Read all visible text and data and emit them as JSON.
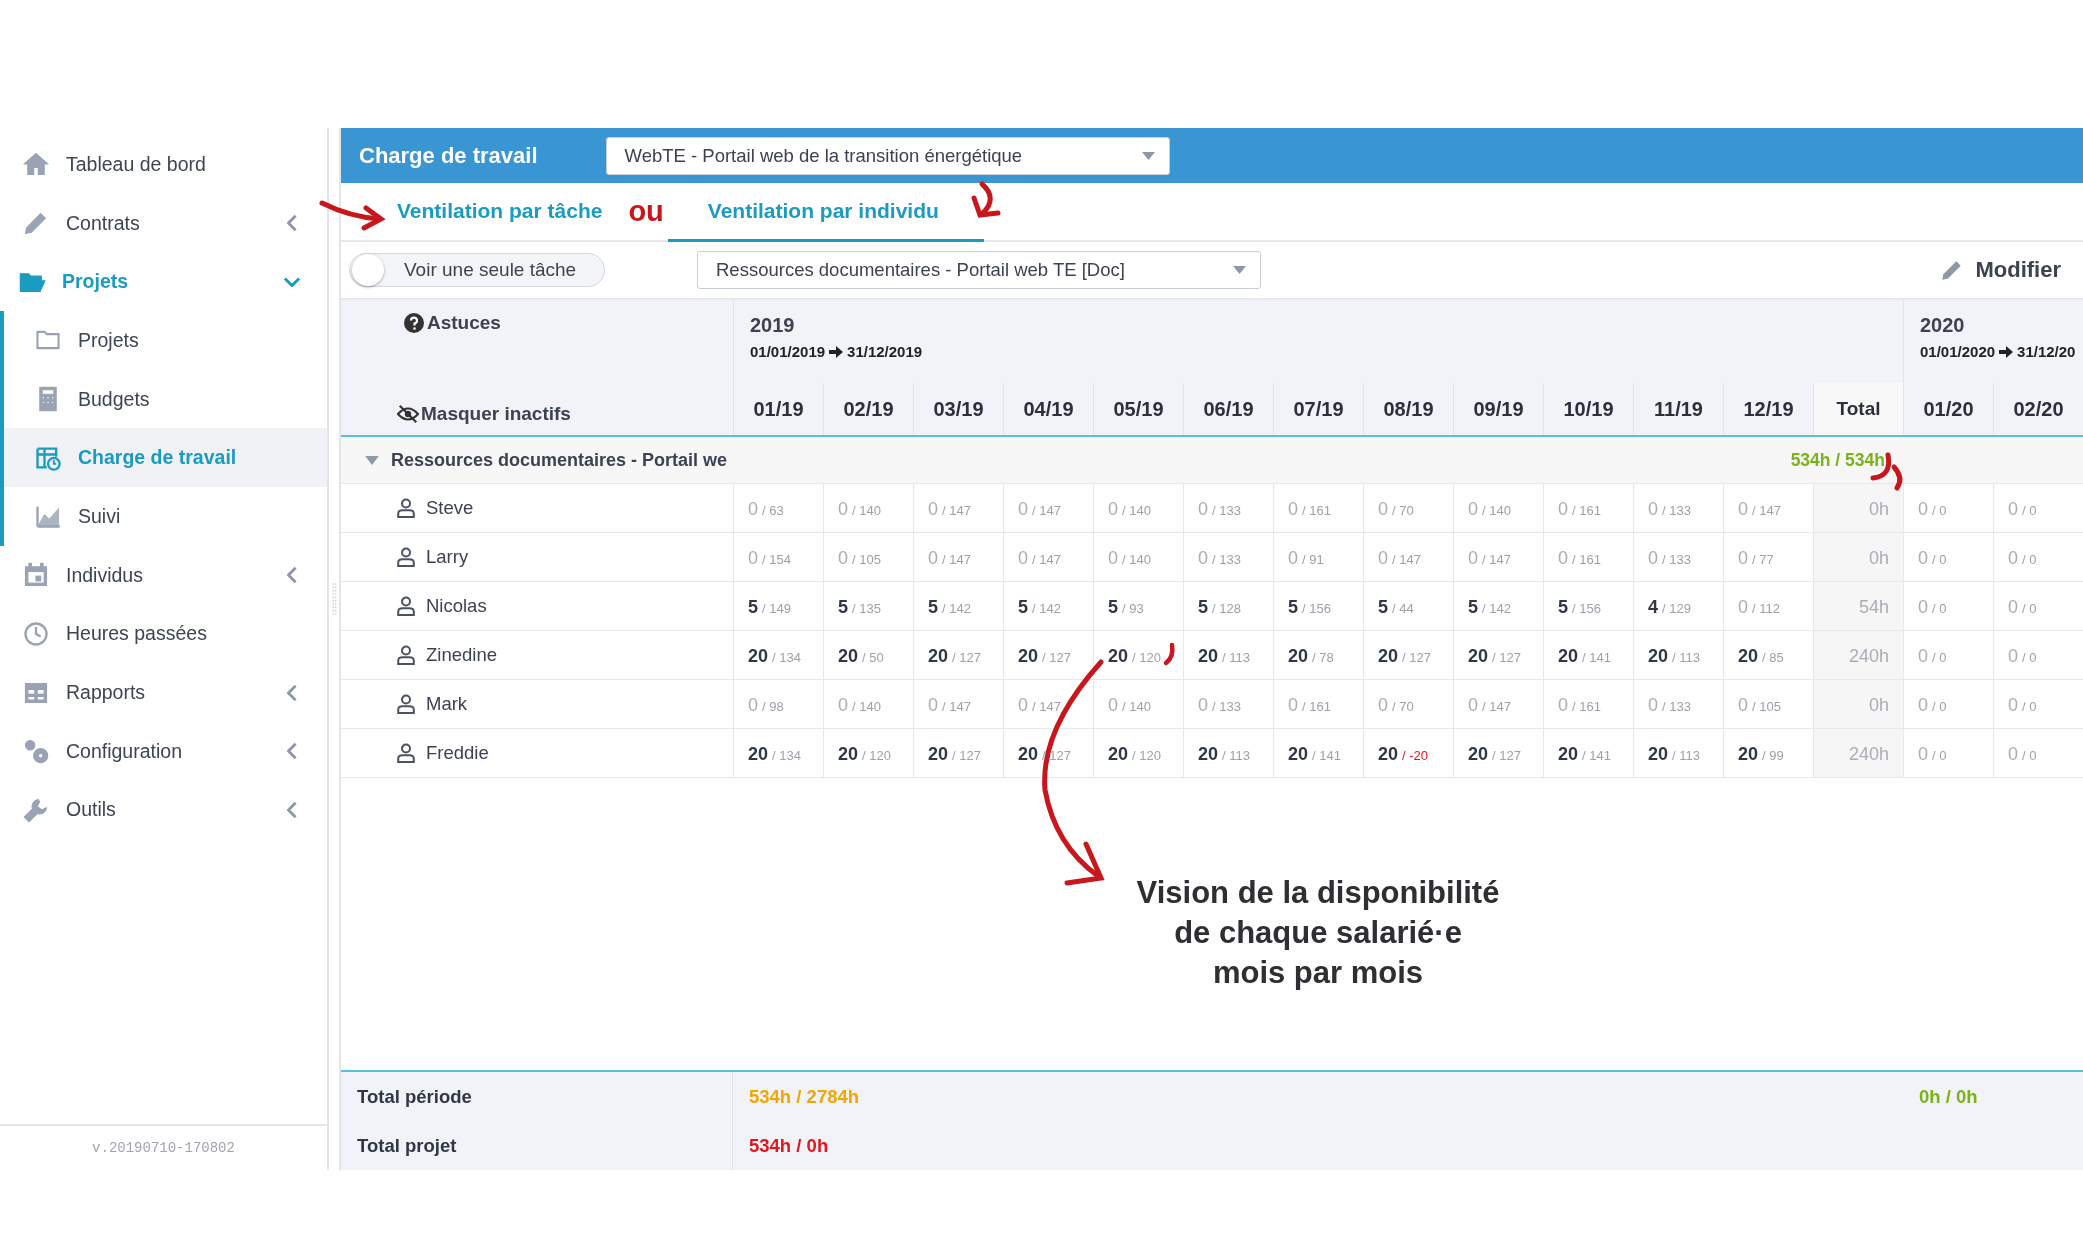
{
  "sidebar": {
    "items": [
      {
        "label": "Tableau de bord",
        "selected": false
      },
      {
        "label": "Contrats",
        "selected": false,
        "expanded": false
      },
      {
        "label": "Projets",
        "selected": true,
        "expanded": true,
        "children": [
          {
            "label": "Projets",
            "selected": false
          },
          {
            "label": "Budgets",
            "selected": false
          },
          {
            "label": "Charge de travail",
            "selected": true
          },
          {
            "label": "Suivi",
            "selected": false
          }
        ]
      },
      {
        "label": "Individus",
        "selected": false,
        "expanded": false
      },
      {
        "label": "Heures passées",
        "selected": false
      },
      {
        "label": "Rapports",
        "selected": false,
        "expanded": false
      },
      {
        "label": "Configuration",
        "selected": false,
        "expanded": false
      },
      {
        "label": "Outils",
        "selected": false,
        "expanded": false
      }
    ],
    "version": "v.20190710-170802"
  },
  "header": {
    "title": "Charge de travail",
    "project_select": "WebTE - Portail web de la transition énergétique"
  },
  "tabs": [
    {
      "label": "Ventilation par tâche",
      "selected": false
    },
    {
      "label": "Ventilation par individu",
      "selected": true
    }
  ],
  "toolbar": {
    "toggle": {
      "label": "Voir une seule tâche",
      "on": false
    },
    "task_select": "Ressources documentaires - Portail web TE [Doc]",
    "edit_button": "Modifier"
  },
  "table": {
    "tips": "Astuces",
    "hide_inactive": "Masquer inactifs",
    "years": [
      {
        "year": "2019",
        "range_start": "01/01/2019",
        "range_end": "31/12/2019",
        "months": [
          "01/19",
          "02/19",
          "03/19",
          "04/19",
          "05/19",
          "06/19",
          "07/19",
          "08/19",
          "09/19",
          "10/19",
          "11/19",
          "12/19"
        ],
        "total": "Total"
      },
      {
        "year": "2020",
        "range_start": "01/01/2020",
        "range_end": "31/12/20",
        "months": [
          "01/20",
          "02/20"
        ]
      }
    ],
    "group": {
      "label": "Ressources documentaires - Portail we",
      "expanded": true,
      "total": "534h / 534h"
    },
    "rows": [
      {
        "name": "Steve",
        "total": "0h",
        "cells": [
          {
            "h": "0",
            "cap": "/ 63",
            "kind": "empty"
          },
          {
            "h": "0",
            "cap": "/ 140",
            "kind": "empty"
          },
          {
            "h": "0",
            "cap": "/ 147",
            "kind": "empty"
          },
          {
            "h": "0",
            "cap": "/ 147",
            "kind": "empty"
          },
          {
            "h": "0",
            "cap": "/ 140",
            "kind": "empty"
          },
          {
            "h": "0",
            "cap": "/ 133",
            "kind": "empty"
          },
          {
            "h": "0",
            "cap": "/ 161",
            "kind": "empty"
          },
          {
            "h": "0",
            "cap": "/ 70",
            "kind": "empty"
          },
          {
            "h": "0",
            "cap": "/ 140",
            "kind": "empty"
          },
          {
            "h": "0",
            "cap": "/ 161",
            "kind": "empty"
          },
          {
            "h": "0",
            "cap": "/ 133",
            "kind": "empty"
          },
          {
            "h": "0",
            "cap": "/ 147",
            "kind": "empty"
          }
        ],
        "next": [
          {
            "h": "0",
            "cap": "/ 0",
            "kind": "empty"
          },
          {
            "h": "0",
            "cap": "/ 0",
            "kind": "empty"
          }
        ]
      },
      {
        "name": "Larry",
        "total": "0h",
        "cells": [
          {
            "h": "0",
            "cap": "/ 154",
            "kind": "empty"
          },
          {
            "h": "0",
            "cap": "/ 105",
            "kind": "empty"
          },
          {
            "h": "0",
            "cap": "/ 147",
            "kind": "empty"
          },
          {
            "h": "0",
            "cap": "/ 147",
            "kind": "empty"
          },
          {
            "h": "0",
            "cap": "/ 140",
            "kind": "empty"
          },
          {
            "h": "0",
            "cap": "/ 133",
            "kind": "empty"
          },
          {
            "h": "0",
            "cap": "/ 91",
            "kind": "empty"
          },
          {
            "h": "0",
            "cap": "/ 147",
            "kind": "empty"
          },
          {
            "h": "0",
            "cap": "/ 147",
            "kind": "empty"
          },
          {
            "h": "0",
            "cap": "/ 161",
            "kind": "empty"
          },
          {
            "h": "0",
            "cap": "/ 133",
            "kind": "empty"
          },
          {
            "h": "0",
            "cap": "/ 77",
            "kind": "empty"
          }
        ],
        "next": [
          {
            "h": "0",
            "cap": "/ 0",
            "kind": "empty"
          },
          {
            "h": "0",
            "cap": "/ 0",
            "kind": "empty"
          }
        ]
      },
      {
        "name": "Nicolas",
        "total": "54h",
        "cells": [
          {
            "h": "5",
            "cap": "/ 149",
            "kind": "filled"
          },
          {
            "h": "5",
            "cap": "/ 135",
            "kind": "filled"
          },
          {
            "h": "5",
            "cap": "/ 142",
            "kind": "filled"
          },
          {
            "h": "5",
            "cap": "/ 142",
            "kind": "filled"
          },
          {
            "h": "5",
            "cap": "/ 93",
            "kind": "filled"
          },
          {
            "h": "5",
            "cap": "/ 128",
            "kind": "filled"
          },
          {
            "h": "5",
            "cap": "/ 156",
            "kind": "filled"
          },
          {
            "h": "5",
            "cap": "/ 44",
            "kind": "filled"
          },
          {
            "h": "5",
            "cap": "/ 142",
            "kind": "filled"
          },
          {
            "h": "5",
            "cap": "/ 156",
            "kind": "filled"
          },
          {
            "h": "4",
            "cap": "/ 129",
            "kind": "filled"
          },
          {
            "h": "0",
            "cap": "/ 112",
            "kind": "empty"
          }
        ],
        "next": [
          {
            "h": "0",
            "cap": "/ 0",
            "kind": "empty"
          },
          {
            "h": "0",
            "cap": "/ 0",
            "kind": "empty"
          }
        ]
      },
      {
        "name": "Zinedine",
        "total": "240h",
        "cells": [
          {
            "h": "20",
            "cap": "/ 134",
            "kind": "filled"
          },
          {
            "h": "20",
            "cap": "/ 50",
            "kind": "filled"
          },
          {
            "h": "20",
            "cap": "/ 127",
            "kind": "filled"
          },
          {
            "h": "20",
            "cap": "/ 127",
            "kind": "filled"
          },
          {
            "h": "20",
            "cap": "/ 120",
            "kind": "filled"
          },
          {
            "h": "20",
            "cap": "/ 113",
            "kind": "filled"
          },
          {
            "h": "20",
            "cap": "/ 78",
            "kind": "filled"
          },
          {
            "h": "20",
            "cap": "/ 127",
            "kind": "filled"
          },
          {
            "h": "20",
            "cap": "/ 127",
            "kind": "filled"
          },
          {
            "h": "20",
            "cap": "/ 141",
            "kind": "filled"
          },
          {
            "h": "20",
            "cap": "/ 113",
            "kind": "filled"
          },
          {
            "h": "20",
            "cap": "/ 85",
            "kind": "filled"
          }
        ],
        "next": [
          {
            "h": "0",
            "cap": "/ 0",
            "kind": "empty"
          },
          {
            "h": "0",
            "cap": "/ 0",
            "kind": "empty"
          }
        ]
      },
      {
        "name": "Mark",
        "total": "0h",
        "cells": [
          {
            "h": "0",
            "cap": "/ 98",
            "kind": "empty"
          },
          {
            "h": "0",
            "cap": "/ 140",
            "kind": "empty"
          },
          {
            "h": "0",
            "cap": "/ 147",
            "kind": "empty"
          },
          {
            "h": "0",
            "cap": "/ 147",
            "kind": "empty"
          },
          {
            "h": "0",
            "cap": "/ 140",
            "kind": "empty"
          },
          {
            "h": "0",
            "cap": "/ 133",
            "kind": "empty"
          },
          {
            "h": "0",
            "cap": "/ 161",
            "kind": "empty"
          },
          {
            "h": "0",
            "cap": "/ 70",
            "kind": "empty"
          },
          {
            "h": "0",
            "cap": "/ 147",
            "kind": "empty"
          },
          {
            "h": "0",
            "cap": "/ 161",
            "kind": "empty"
          },
          {
            "h": "0",
            "cap": "/ 133",
            "kind": "empty"
          },
          {
            "h": "0",
            "cap": "/ 105",
            "kind": "empty"
          }
        ],
        "next": [
          {
            "h": "0",
            "cap": "/ 0",
            "kind": "empty"
          },
          {
            "h": "0",
            "cap": "/ 0",
            "kind": "empty"
          }
        ]
      },
      {
        "name": "Freddie",
        "total": "240h",
        "cells": [
          {
            "h": "20",
            "cap": "/ 134",
            "kind": "filled"
          },
          {
            "h": "20",
            "cap": "/ 120",
            "kind": "filled"
          },
          {
            "h": "20",
            "cap": "/ 127",
            "kind": "filled"
          },
          {
            "h": "20",
            "cap": "/ 127",
            "kind": "filled"
          },
          {
            "h": "20",
            "cap": "/ 120",
            "kind": "filled"
          },
          {
            "h": "20",
            "cap": "/ 113",
            "kind": "filled"
          },
          {
            "h": "20",
            "cap": "/ 141",
            "kind": "filled"
          },
          {
            "h": "20",
            "cap": "/ -20",
            "kind": "over"
          },
          {
            "h": "20",
            "cap": "/ 127",
            "kind": "filled"
          },
          {
            "h": "20",
            "cap": "/ 141",
            "kind": "filled"
          },
          {
            "h": "20",
            "cap": "/ 113",
            "kind": "filled"
          },
          {
            "h": "20",
            "cap": "/ 99",
            "kind": "filled"
          }
        ],
        "next": [
          {
            "h": "0",
            "cap": "/ 0",
            "kind": "empty"
          },
          {
            "h": "0",
            "cap": "/ 0",
            "kind": "empty"
          }
        ]
      }
    ]
  },
  "footer": {
    "period_label": "Total période",
    "period_value": "534h / 2784h",
    "period_next": "0h / 0h",
    "project_label": "Total projet",
    "project_value": "534h / 0h"
  },
  "annotation": {
    "connector": "ou",
    "note": [
      "Vision de la disponibilité",
      "de chaque salarié·e",
      "mois par mois"
    ]
  }
}
